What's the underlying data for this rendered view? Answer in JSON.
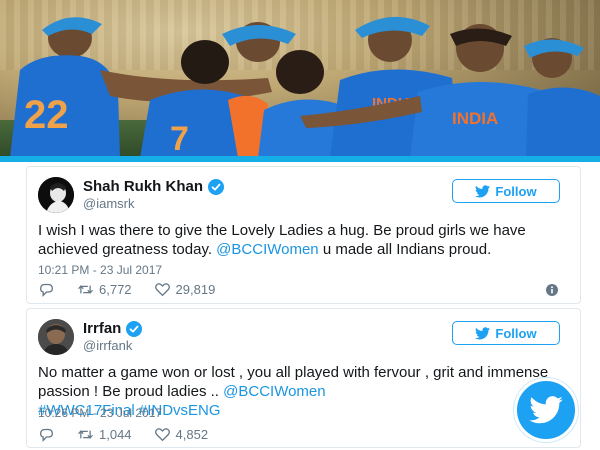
{
  "colors": {
    "twitter_blue": "#1da1f2",
    "link_blue": "#1b95e0",
    "jersey_blue": "#1f6fd1",
    "banner_border": "#16aee6"
  },
  "photo": {
    "jersey_text": "INDIA",
    "jersey_numbers": [
      "22",
      "7"
    ]
  },
  "tweets": [
    {
      "display_name": "Shah Rukh Khan",
      "handle": "@iamsrk",
      "follow_label": "Follow",
      "text_before_link": "I wish I was there to give the Lovely Ladies a hug. Be proud girls we have achieved greatness today. ",
      "link": "@BCCIWomen",
      "text_after_link": " u made all Indians proud.",
      "timestamp": "10:21 PM - 23 Jul 2017",
      "retweets": "6,772",
      "likes": "29,819"
    },
    {
      "display_name": "Irrfan",
      "handle": "@irrfank",
      "follow_label": "Follow",
      "text_before_link": "No matter a game won or lost , you all played with fervour , grit and immense passion ! Be proud ladies .. ",
      "link": "@BCCIWomen",
      "hashtags": "#WWC17Final #INDvsENG",
      "timestamp": "10:26 PM - 23 Jul 2017",
      "retweets": "1,044",
      "likes": "4,852"
    }
  ]
}
